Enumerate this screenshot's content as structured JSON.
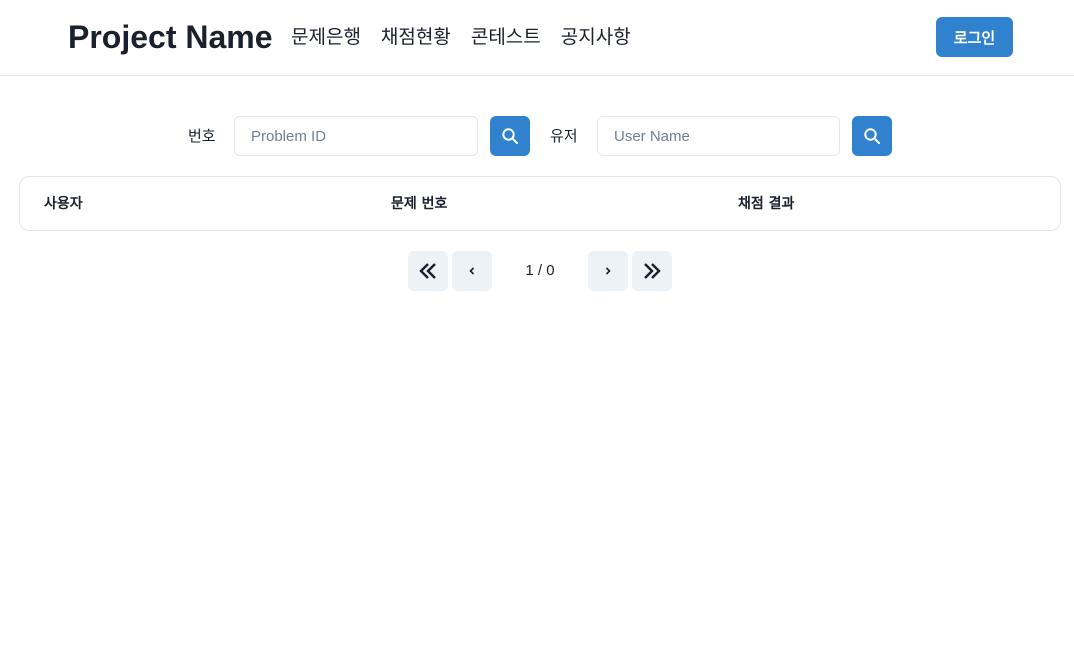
{
  "header": {
    "brand": "Project Name",
    "nav": [
      "문제은행",
      "채점현황",
      "콘테스트",
      "공지사항"
    ],
    "login_label": "로그인"
  },
  "search": {
    "problem_label": "번호",
    "problem_placeholder": "Problem ID",
    "problem_value": "",
    "user_label": "유저",
    "user_placeholder": "User Name",
    "user_value": ""
  },
  "table": {
    "columns": [
      "사용자",
      "문제 번호",
      "채점 결과"
    ],
    "rows": []
  },
  "pagination": {
    "info": "1 / 0"
  },
  "colors": {
    "accent": "#3182ce",
    "border": "#e2e8f0",
    "pager_bg": "#edf2f7"
  },
  "icons": {
    "search_buttons": "search-icon",
    "first_page": "double-chevron-left-icon",
    "prev_page": "chevron-left-icon",
    "next_page": "chevron-right-icon",
    "last_page": "double-chevron-right-icon"
  }
}
